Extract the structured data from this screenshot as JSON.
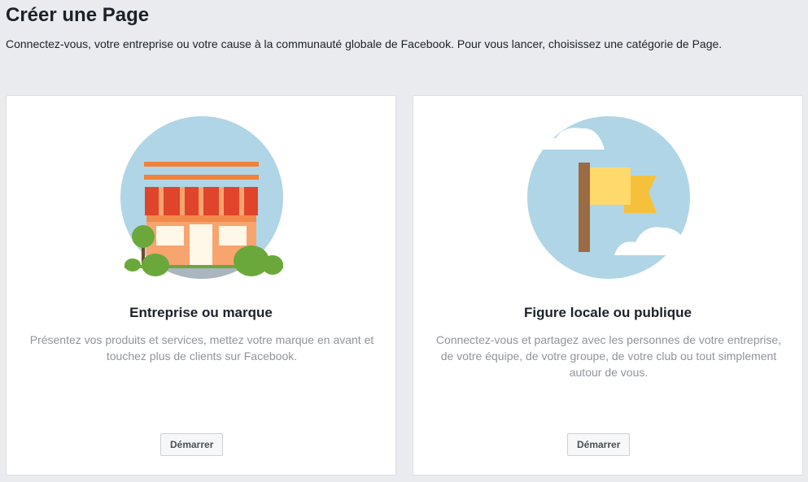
{
  "header": {
    "title": "Créer une Page",
    "subtitle": "Connectez-vous, votre entreprise ou votre cause à la communauté globale de Facebook. Pour vous lancer, choisissez une catégorie de Page."
  },
  "cards": [
    {
      "icon": "storefront-icon",
      "title": "Entreprise ou marque",
      "description": "Présentez vos produits et services, mettez votre marque en avant et touchez plus de clients sur Facebook.",
      "button_label": "Démarrer"
    },
    {
      "icon": "flag-icon",
      "title": "Figure locale ou publique",
      "description": "Connectez-vous et partagez avec les personnes de votre entreprise, de votre équipe, de votre groupe, de votre club ou tout simplement autour de vous.",
      "button_label": "Démarrer"
    }
  ],
  "colors": {
    "background": "#e9ebee",
    "circle": "#b0d5e6",
    "awning_red": "#e0442a",
    "building_orange": "#f7a46f",
    "flag_yellow": "#f5c13b",
    "pole_brown": "#9b6b44",
    "bush_green": "#6aa83b"
  }
}
